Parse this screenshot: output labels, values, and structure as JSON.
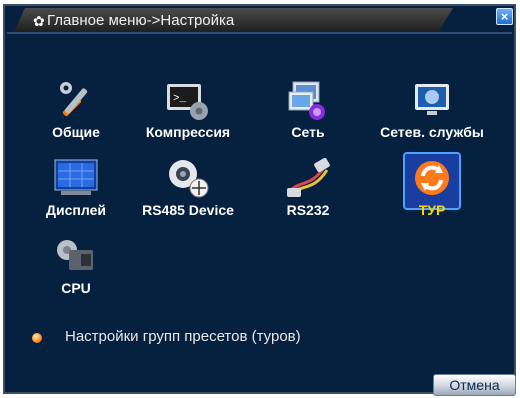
{
  "window": {
    "title": "Главное меню->Настройка",
    "close_glyph": "×"
  },
  "menu": {
    "items": [
      {
        "label": "Общие",
        "icon": "tools-icon"
      },
      {
        "label": "Компрессия",
        "icon": "terminal-gear-icon"
      },
      {
        "label": "Сеть",
        "icon": "network-computer-icon"
      },
      {
        "label": "Сетев. службы",
        "icon": "monitor-globe-icon"
      },
      {
        "label": "Дисплей",
        "icon": "display-icon"
      },
      {
        "label": "RS485 Device",
        "icon": "camera-device-icon"
      },
      {
        "label": "RS232",
        "icon": "serial-cable-icon"
      },
      {
        "label": "ТУР",
        "icon": "tour-refresh-icon"
      },
      {
        "label": "CPU",
        "icon": "cpu-camera-icon"
      }
    ],
    "selected": "ТУР"
  },
  "status": {
    "hint": "Настройки групп пресетов (туров)"
  },
  "footer": {
    "cancel_label": "Отмена"
  },
  "colors": {
    "background": "#06203f",
    "title_bar": "#2a2a2a",
    "label": "#ffffff",
    "selected_label": "#ffd400",
    "focus": "#1a3ea0"
  }
}
